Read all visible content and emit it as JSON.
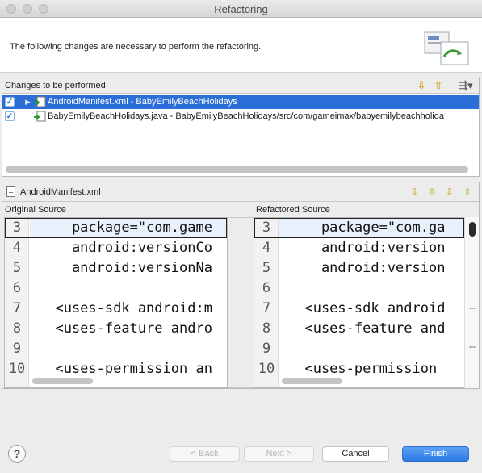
{
  "window": {
    "title": "Refactoring"
  },
  "header": {
    "message": "The following changes are necessary to perform the refactoring."
  },
  "changes": {
    "title": "Changes to be performed",
    "items": [
      {
        "label": "AndroidManifest.xml - BabyEmilyBeachHolidays",
        "checked": true,
        "selected": true
      },
      {
        "label": "BabyEmilyBeachHolidays.java - BabyEmilyBeachHolidays/src/com/gameimax/babyemilybeachholida",
        "checked": true,
        "selected": false
      }
    ]
  },
  "compare": {
    "file": "AndroidManifest.xml",
    "original_label": "Original Source",
    "refactored_label": "Refactored Source",
    "original_lines": [
      {
        "num": "3",
        "text": "    package=\"com.game"
      },
      {
        "num": "4",
        "text": "    android:versionCo"
      },
      {
        "num": "5",
        "text": "    android:versionNa"
      },
      {
        "num": "6",
        "text": ""
      },
      {
        "num": "7",
        "text": "  <uses-sdk android:m"
      },
      {
        "num": "8",
        "text": "  <uses-feature andro"
      },
      {
        "num": "9",
        "text": ""
      },
      {
        "num": "10",
        "text": "  <uses-permission an"
      }
    ],
    "refactored_lines": [
      {
        "num": "3",
        "text": "    package=\"com.ga"
      },
      {
        "num": "4",
        "text": "    android:version"
      },
      {
        "num": "5",
        "text": "    android:version"
      },
      {
        "num": "6",
        "text": ""
      },
      {
        "num": "7",
        "text": "  <uses-sdk android"
      },
      {
        "num": "8",
        "text": "  <uses-feature and"
      },
      {
        "num": "9",
        "text": ""
      },
      {
        "num": "10",
        "text": "  <uses-permission"
      }
    ]
  },
  "buttons": {
    "help": "?",
    "back": "< Back",
    "next": "Next >",
    "cancel": "Cancel",
    "finish": "Finish"
  },
  "colors": {
    "selection": "#2b6ed8",
    "primary_button": "#2f7be6"
  }
}
